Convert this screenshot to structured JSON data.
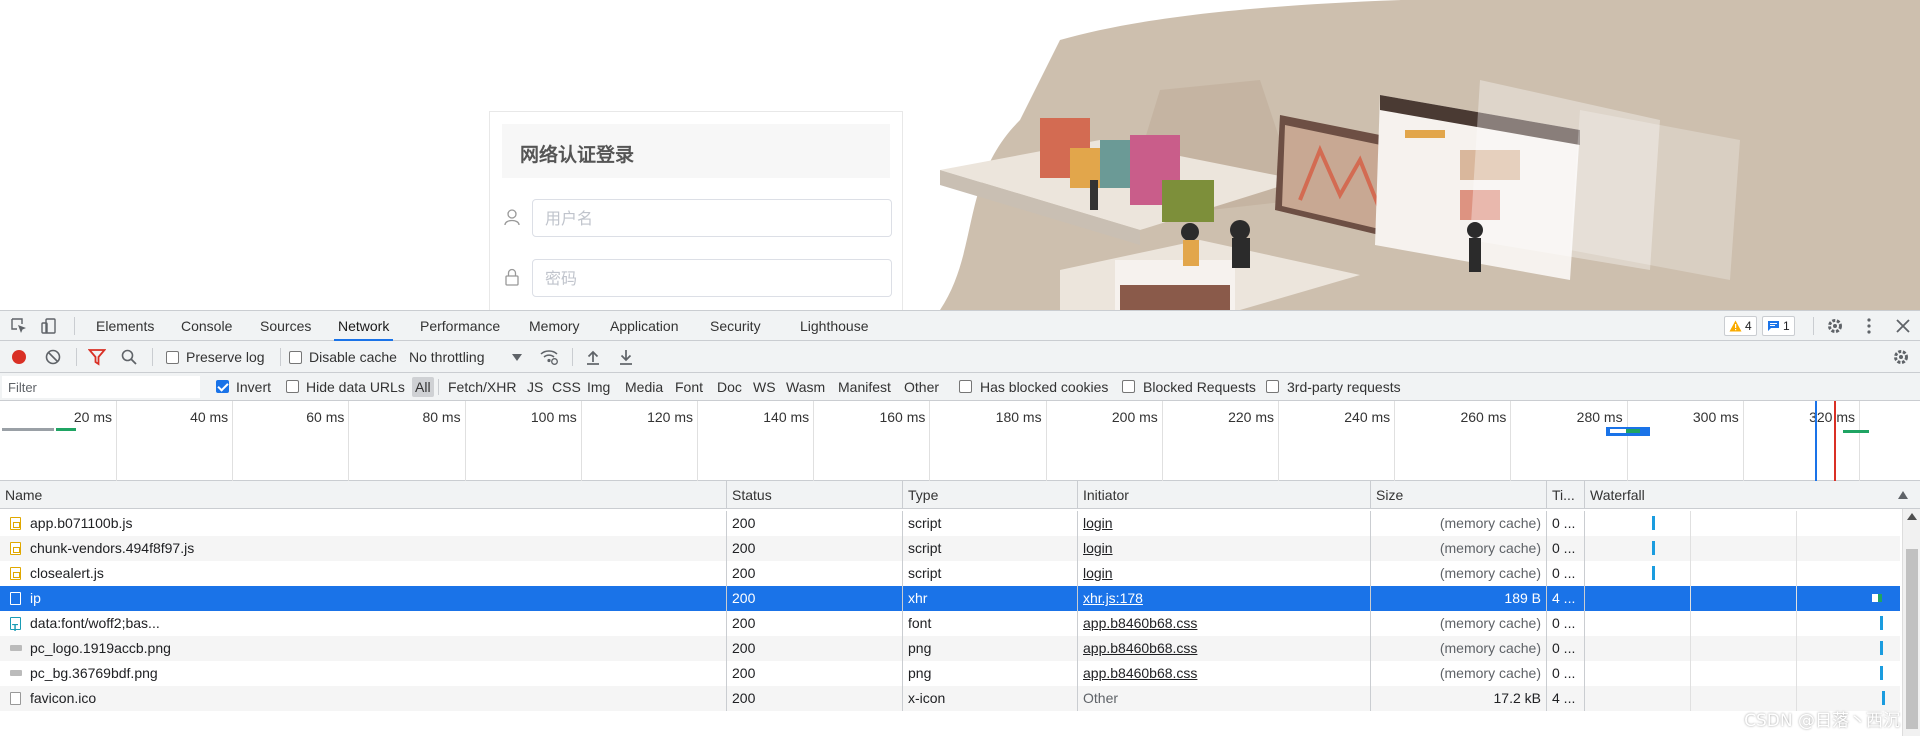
{
  "login": {
    "title": "网络认证登录",
    "username_placeholder": "用户名",
    "password_placeholder": "密码"
  },
  "devtools": {
    "tabs": [
      {
        "label": "Elements"
      },
      {
        "label": "Console"
      },
      {
        "label": "Sources"
      },
      {
        "label": "Network",
        "active": true
      },
      {
        "label": "Performance"
      },
      {
        "label": "Memory"
      },
      {
        "label": "Application"
      },
      {
        "label": "Security"
      },
      {
        "label": "Lighthouse"
      }
    ],
    "warnings_count": "4",
    "messages_count": "1",
    "toolbar": {
      "preserve_log": "Preserve log",
      "disable_cache": "Disable cache",
      "throttling": "No throttling"
    },
    "filter": {
      "placeholder": "Filter",
      "invert": "Invert",
      "hide_data_urls": "Hide data URLs",
      "types": [
        "All",
        "Fetch/XHR",
        "JS",
        "CSS",
        "Img",
        "Media",
        "Font",
        "Doc",
        "WS",
        "Wasm",
        "Manifest",
        "Other"
      ],
      "has_blocked_cookies": "Has blocked cookies",
      "blocked_requests": "Blocked Requests",
      "third_party": "3rd-party requests"
    },
    "overview_ticks": [
      "20 ms",
      "40 ms",
      "60 ms",
      "80 ms",
      "100 ms",
      "120 ms",
      "140 ms",
      "160 ms",
      "180 ms",
      "200 ms",
      "220 ms",
      "240 ms",
      "260 ms",
      "280 ms",
      "300 ms",
      "320 ms"
    ],
    "columns": {
      "name": "Name",
      "status": "Status",
      "type": "Type",
      "initiator": "Initiator",
      "size": "Size",
      "time": "Ti...",
      "waterfall": "Waterfall"
    },
    "rows": [
      {
        "name": "app.b071100b.js",
        "status": "200",
        "type": "script",
        "initiator": "login",
        "size": "(memory cache)",
        "time": "0 ...",
        "icon": "js"
      },
      {
        "name": "chunk-vendors.494f8f97.js",
        "status": "200",
        "type": "script",
        "initiator": "login",
        "size": "(memory cache)",
        "time": "0 ...",
        "icon": "js"
      },
      {
        "name": "closealert.js",
        "status": "200",
        "type": "script",
        "initiator": "login",
        "size": "(memory cache)",
        "time": "0 ...",
        "icon": "js"
      },
      {
        "name": "ip",
        "status": "200",
        "type": "xhr",
        "initiator": "xhr.js:178",
        "size": "189 B",
        "time": "4 ...",
        "icon": "doc",
        "selected": true
      },
      {
        "name": "data:font/woff2;bas...",
        "status": "200",
        "type": "font",
        "initiator": "app.b8460b68.css",
        "size": "(memory cache)",
        "time": "0 ...",
        "icon": "font"
      },
      {
        "name": "pc_logo.1919accb.png",
        "status": "200",
        "type": "png",
        "initiator": "app.b8460b68.css",
        "size": "(memory cache)",
        "time": "0 ...",
        "icon": "img"
      },
      {
        "name": "pc_bg.36769bdf.png",
        "status": "200",
        "type": "png",
        "initiator": "app.b8460b68.css",
        "size": "(memory cache)",
        "time": "0 ...",
        "icon": "img"
      },
      {
        "name": "favicon.ico",
        "status": "200",
        "type": "x-icon",
        "initiator": "Other",
        "size": "17.2 kB",
        "time": "4 ...",
        "icon": "doc"
      }
    ]
  },
  "watermark": "CSDN @日落丶西沉",
  "colors": {
    "accent": "#1a73e8",
    "record": "#d93025"
  }
}
